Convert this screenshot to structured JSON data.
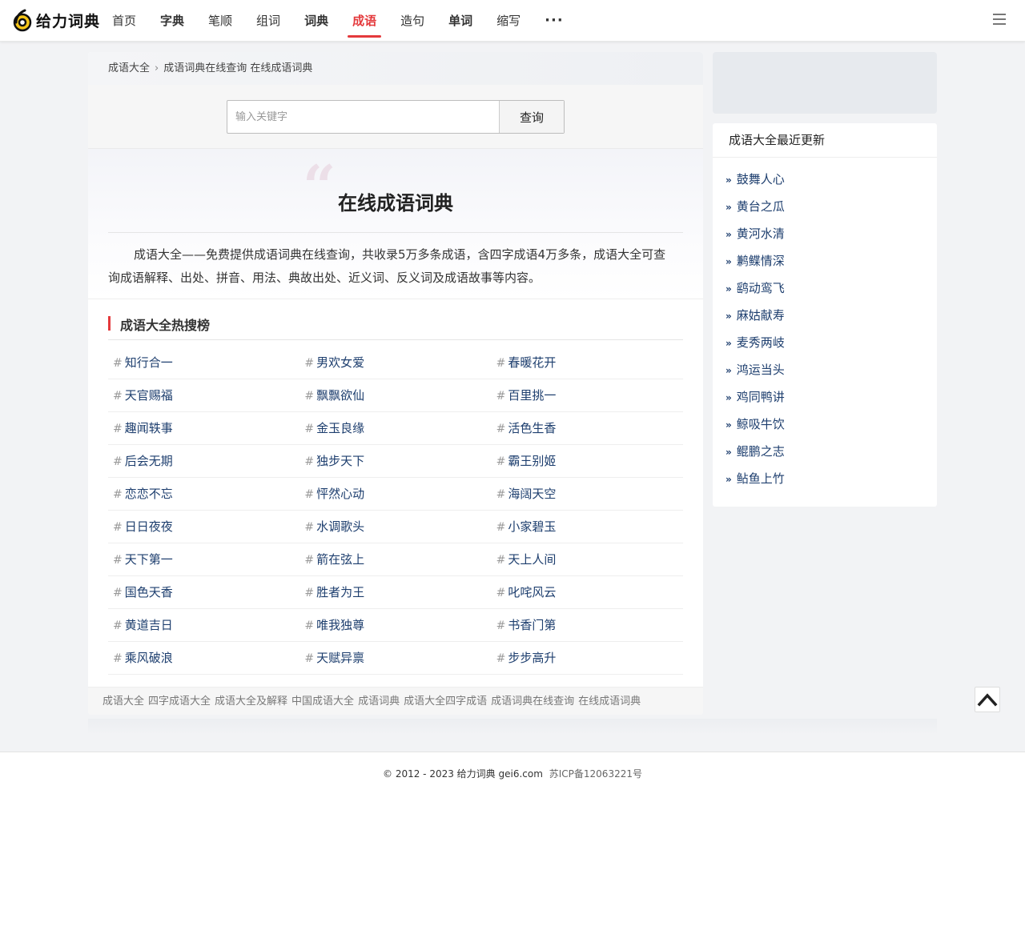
{
  "header": {
    "logo_text": "给力词典",
    "nav": [
      {
        "label": "首页",
        "bold": false,
        "active": false
      },
      {
        "label": "字典",
        "bold": true,
        "active": false
      },
      {
        "label": "笔顺",
        "bold": false,
        "active": false
      },
      {
        "label": "组词",
        "bold": false,
        "active": false
      },
      {
        "label": "词典",
        "bold": true,
        "active": false
      },
      {
        "label": "成语",
        "bold": true,
        "active": true
      },
      {
        "label": "造句",
        "bold": false,
        "active": false
      },
      {
        "label": "单词",
        "bold": true,
        "active": false
      },
      {
        "label": "缩写",
        "bold": false,
        "active": false
      }
    ],
    "more_label": "···"
  },
  "breadcrumb": {
    "home": "成语大全",
    "separator": "›",
    "current": "成语词典在线查询 在线成语词典"
  },
  "search": {
    "placeholder": "输入关键字",
    "value": "",
    "button_label": "查询"
  },
  "intro": {
    "title": "在线成语词典",
    "text": "成语大全——免费提供成语词典在线查询，共收录5万多条成语，含四字成语4万多条，成语大全可查询成语解释、出处、拼音、用法、典故出处、近义词、反义词及成语故事等内容。"
  },
  "hot": {
    "title": "成语大全热搜榜",
    "hash": "#",
    "rows": [
      [
        "知行合一",
        "男欢女爱",
        "春暖花开"
      ],
      [
        "天官赐福",
        "飘飘欲仙",
        "百里挑一"
      ],
      [
        "趣闻轶事",
        "金玉良缘",
        "活色生香"
      ],
      [
        "后会无期",
        "独步天下",
        "霸王别姬"
      ],
      [
        "恋恋不忘",
        "怦然心动",
        "海阔天空"
      ],
      [
        "日日夜夜",
        "水调歌头",
        "小家碧玉"
      ],
      [
        "天下第一",
        "箭在弦上",
        "天上人间"
      ],
      [
        "国色天香",
        "胜者为王",
        "叱咤风云"
      ],
      [
        "黄道吉日",
        "唯我独尊",
        "书香门第"
      ],
      [
        "乘风破浪",
        "天赋异禀",
        "步步高升"
      ]
    ]
  },
  "tags": [
    "成语大全",
    "四字成语大全",
    "成语大全及解释",
    "中国成语大全",
    "成语词典",
    "成语大全四字成语",
    "成语词典在线查询",
    "在线成语词典"
  ],
  "sidebar": {
    "title": "成语大全最近更新",
    "bullet": "»",
    "items": [
      "鼓舞人心",
      "黄台之瓜",
      "黄河水清",
      "鹣鲽情深",
      "鹞动鸾飞",
      "麻姑献寿",
      "麦秀两岐",
      "鸿运当头",
      "鸡同鸭讲",
      "鲸吸牛饮",
      "鲲鹏之志",
      "鲇鱼上竹"
    ]
  },
  "footer": {
    "copyright": "© 2012 - 2023 给力词典 gei6.com",
    "icp": "苏ICP备12063221号"
  },
  "colors": {
    "accent": "#e4393c",
    "link": "#1d3e6e",
    "background": "#f2f3f5"
  },
  "icons": [
    "logo-6-icon",
    "menu-icon",
    "chevron-right-icon",
    "chevron-up-icon"
  ]
}
